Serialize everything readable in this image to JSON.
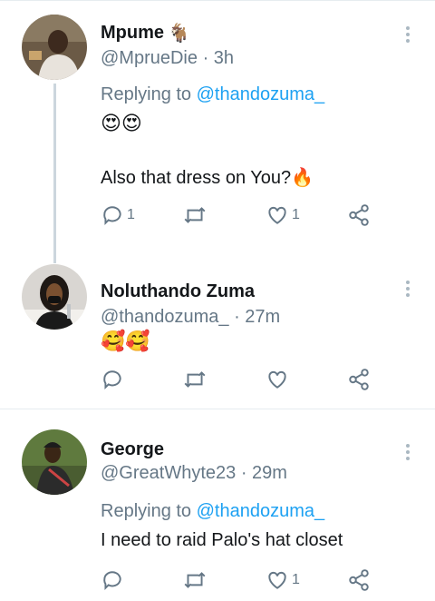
{
  "tweets": [
    {
      "name": "Mpume",
      "name_emoji": "🐐",
      "handle": "@MprueDie",
      "time": "· 3h",
      "reply_prefix": "Replying to",
      "reply_to": "@thandozuma_",
      "emoji_line": "😍😍",
      "text": "Also that dress on You?",
      "text_emoji": "🔥",
      "reply_count": "1",
      "retweet_count": "",
      "like_count": "1"
    },
    {
      "name": "Noluthando Zuma",
      "handle": "@thandozuma_",
      "time": "· 27m",
      "emoji_line": "🥰🥰",
      "reply_count": "",
      "retweet_count": "",
      "like_count": ""
    },
    {
      "name": "George",
      "handle": "@GreatWhyte23",
      "time": "· 29m",
      "reply_prefix": "Replying to",
      "reply_to": "@thandozuma_",
      "text": "I need to raid Palo's hat closet",
      "reply_count": "",
      "retweet_count": "",
      "like_count": "1"
    }
  ],
  "icons": {
    "reply": "reply-icon",
    "retweet": "retweet-icon",
    "like": "heart-icon",
    "share": "share-icon",
    "more": "more-vertical-icon"
  },
  "colors": {
    "link": "#1da1f2",
    "secondary": "#657786",
    "icon": "#657786",
    "thread": "#ccd6dd"
  }
}
